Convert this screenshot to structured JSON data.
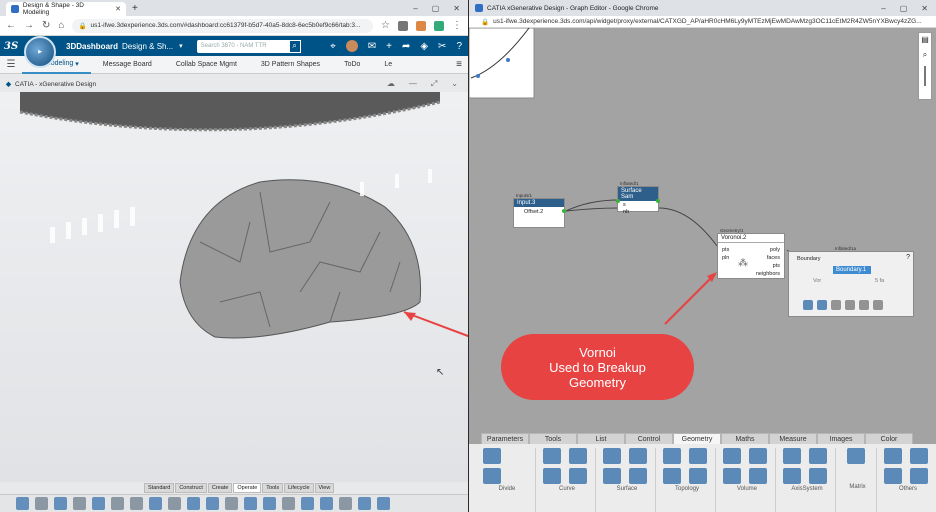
{
  "left_window": {
    "tab_title": "Design & Shape - 3D Modeling",
    "url": "us1-ifwe.3dexperience.3ds.com/#dashboard:cc61379f-b5d7-40a5-8dc8-6ec5b0ef9c66/tab:3...",
    "dashboard_label": "3DDashboard",
    "dashboard_sub": "Design & Sh...",
    "search_placeholder": "Search 3870 - NAM TTR",
    "app_tabs": [
      "3D Modeling",
      "Message Board",
      "Collab Space Mgmt",
      "3D Pattern Shapes",
      "ToDo",
      "Le"
    ],
    "widget_title": "CATIA - xGenerative Design",
    "bottom_tabs": [
      "Standard",
      "Construct",
      "Create",
      "Operate",
      "Tools",
      "Lifecycle",
      "View"
    ],
    "active_bottom_tab": "Operate"
  },
  "right_window": {
    "tab_title": "CATIA xGenerative Design - Graph Editor - Google Chrome",
    "url": "us1-ifwe.3dexperience.3ds.com/api/widget/proxy/external/CATXGD_AP/aHR0cHM6Ly9yMTEzMjEwMDAwMzg3OC11cEtM2R4ZW5nYXBwcy4zZG...",
    "nodes": {
      "input": {
        "category": "Inputs/1",
        "title": "Input.3",
        "body": "Offset.2"
      },
      "surface": {
        "category": "Inflated/1",
        "title": "Surface Sam",
        "ports": [
          "s",
          "nb"
        ]
      },
      "voronoi": {
        "category": "Geometry/1",
        "title": "Voronoi.2",
        "in_ports": [
          "pts",
          "pln"
        ],
        "out_ports": [
          "poly",
          "faces",
          "pts",
          "neighbors"
        ]
      },
      "boundary": {
        "category": "Inflated/1a",
        "panel_label": "Boundary",
        "title": "Boundary.1",
        "field_label": "Vor",
        "field_value": "5 fa"
      }
    },
    "palette_tabs": [
      "Parameters",
      "Tools",
      "List",
      "Control",
      "Geometry",
      "Maths",
      "Measure",
      "Images",
      "Color"
    ],
    "active_palette_tab": "Geometry",
    "palette_groups": [
      "Divide",
      "Curve",
      "Surface",
      "Topology",
      "Volume",
      "AxisSystem",
      "Matrix",
      "Others"
    ]
  },
  "callout": {
    "line1": "Vornoi",
    "line2": "Used to Breakup",
    "line3": "Geometry"
  },
  "colors": {
    "dashboard_blue": "#005386",
    "callout_red": "#e84343",
    "node_header": "#2d5f8a",
    "port_green": "#3bb33b"
  }
}
